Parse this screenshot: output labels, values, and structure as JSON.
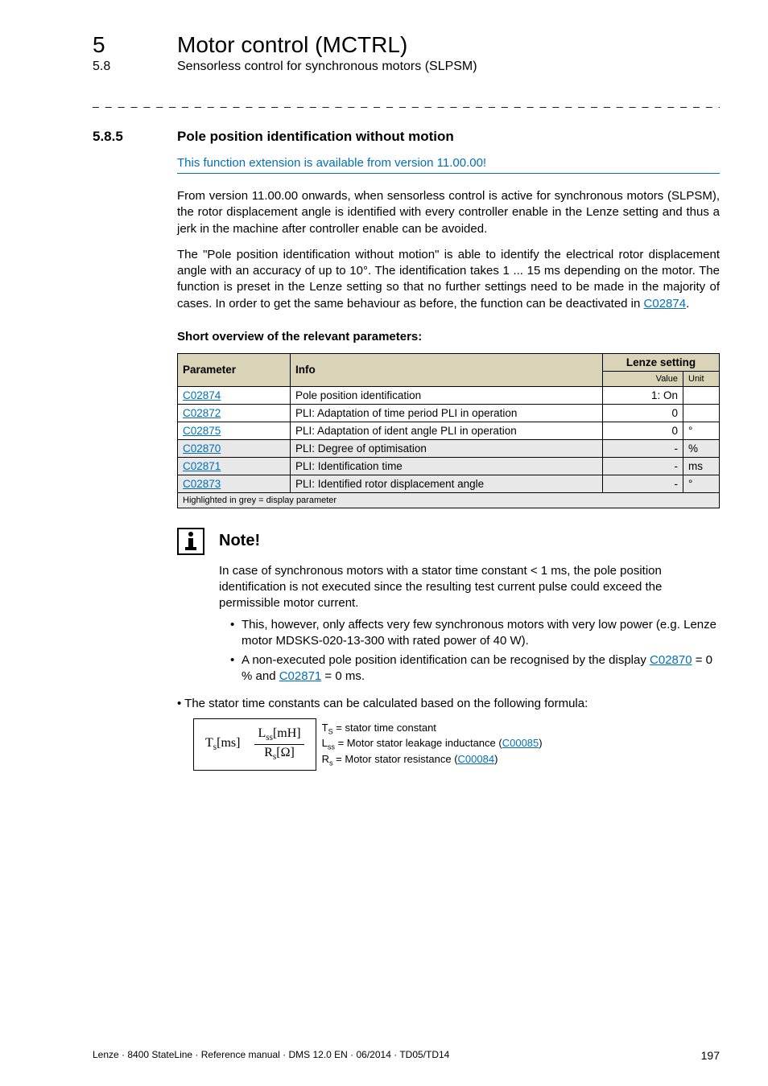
{
  "chapter": {
    "num": "5",
    "title": "Motor control (MCTRL)"
  },
  "subsection": {
    "num": "5.8",
    "title": "Sensorless control for synchronous motors (SLPSM)"
  },
  "divider": "_ _ _ _ _ _ _ _ _ _ _ _ _ _ _ _ _ _ _ _ _ _ _ _ _ _ _ _ _ _ _ _ _ _ _ _ _ _ _ _ _ _ _ _ _ _ _ _ _ _ _ _ _ _ _ _ _ _ _ _ _ _ _ _",
  "section": {
    "num": "5.8.5",
    "title": "Pole position identification without motion"
  },
  "blue_note": "This function extension is available from version 11.00.00!",
  "para1": "From version 11.00.00 onwards, when sensorless control is active for synchronous motors (SLPSM), the rotor displacement angle is identified with every controller enable in the Lenze setting and thus a jerk in the machine after controller enable can be avoided.",
  "para2a": "The \"Pole position identification without motion\" is able to identify the electrical rotor displacement angle with an accuracy of up to 10°. The identification takes 1 ... 15 ms depending on the motor. The function is preset in the Lenze setting so that no further settings need to be made in the majority of cases. In order to get the same behaviour as before, the function can be deactivated in ",
  "para2link": "C02874",
  "para2b": ".",
  "params_heading": "Short overview of the relevant parameters:",
  "table": {
    "h_param": "Parameter",
    "h_info": "Info",
    "h_lenze": "Lenze setting",
    "h_value": "Value",
    "h_unit": "Unit",
    "rows": [
      {
        "p": "C02874",
        "info": "Pole position identification",
        "val": "1: On",
        "unit": "",
        "grey": false
      },
      {
        "p": "C02872",
        "info": "PLI: Adaptation of time period PLI in operation",
        "val": "0",
        "unit": "",
        "grey": false
      },
      {
        "p": "C02875",
        "info": "PLI: Adaptation of ident angle PLI in operation",
        "val": "0",
        "unit": "°",
        "grey": false
      },
      {
        "p": "C02870",
        "info": "PLI: Degree of optimisation",
        "val": "-",
        "unit": "%",
        "grey": true
      },
      {
        "p": "C02871",
        "info": "PLI: Identification time",
        "val": "-",
        "unit": "ms",
        "grey": true
      },
      {
        "p": "C02873",
        "info": "PLI: Identified rotor displacement angle",
        "val": "-",
        "unit": "°",
        "grey": true
      }
    ],
    "footnote": "Highlighted in grey = display parameter"
  },
  "note": {
    "title": "Note!",
    "body1": "In case of synchronous motors with a stator time constant < 1 ms, the pole position identification is not executed since the resulting test current pulse could exceed the permissible motor current.",
    "b1": "This, however, only affects very few synchronous motors with very low power (e.g. Lenze motor MDSKS-020-13-300 with rated power of 40 W).",
    "b2a": "A non-executed pole position identification can be recognised by the display ",
    "b2l1": "C02870",
    "b2mid": " = 0 % and ",
    "b2l2": "C02871",
    "b2end": " = 0 ms."
  },
  "outer_bullet": "The stator time constants can be calculated based on the following formula:",
  "formula": {
    "left": "T",
    "left_sub": "s",
    "left_unit": "[ms]",
    "num": "L",
    "num_sub": "ss",
    "num_unit": "[mH]",
    "den": "R",
    "den_sub": "s",
    "den_unit": "[Ω]",
    "d1a": "T",
    "d1s": "S",
    "d1b": " = stator time constant",
    "d2a": "L",
    "d2s": "ss",
    "d2b": " = Motor stator leakage inductance (",
    "d2l": "C00085",
    "d2c": ")",
    "d3a": "R",
    "d3s": "s",
    "d3b": " = Motor stator resistance (",
    "d3l": "C00084",
    "d3c": ")"
  },
  "footer": {
    "left": "Lenze · 8400 StateLine · Reference manual · DMS 12.0 EN · 06/2014 · TD05/TD14",
    "page": "197"
  }
}
